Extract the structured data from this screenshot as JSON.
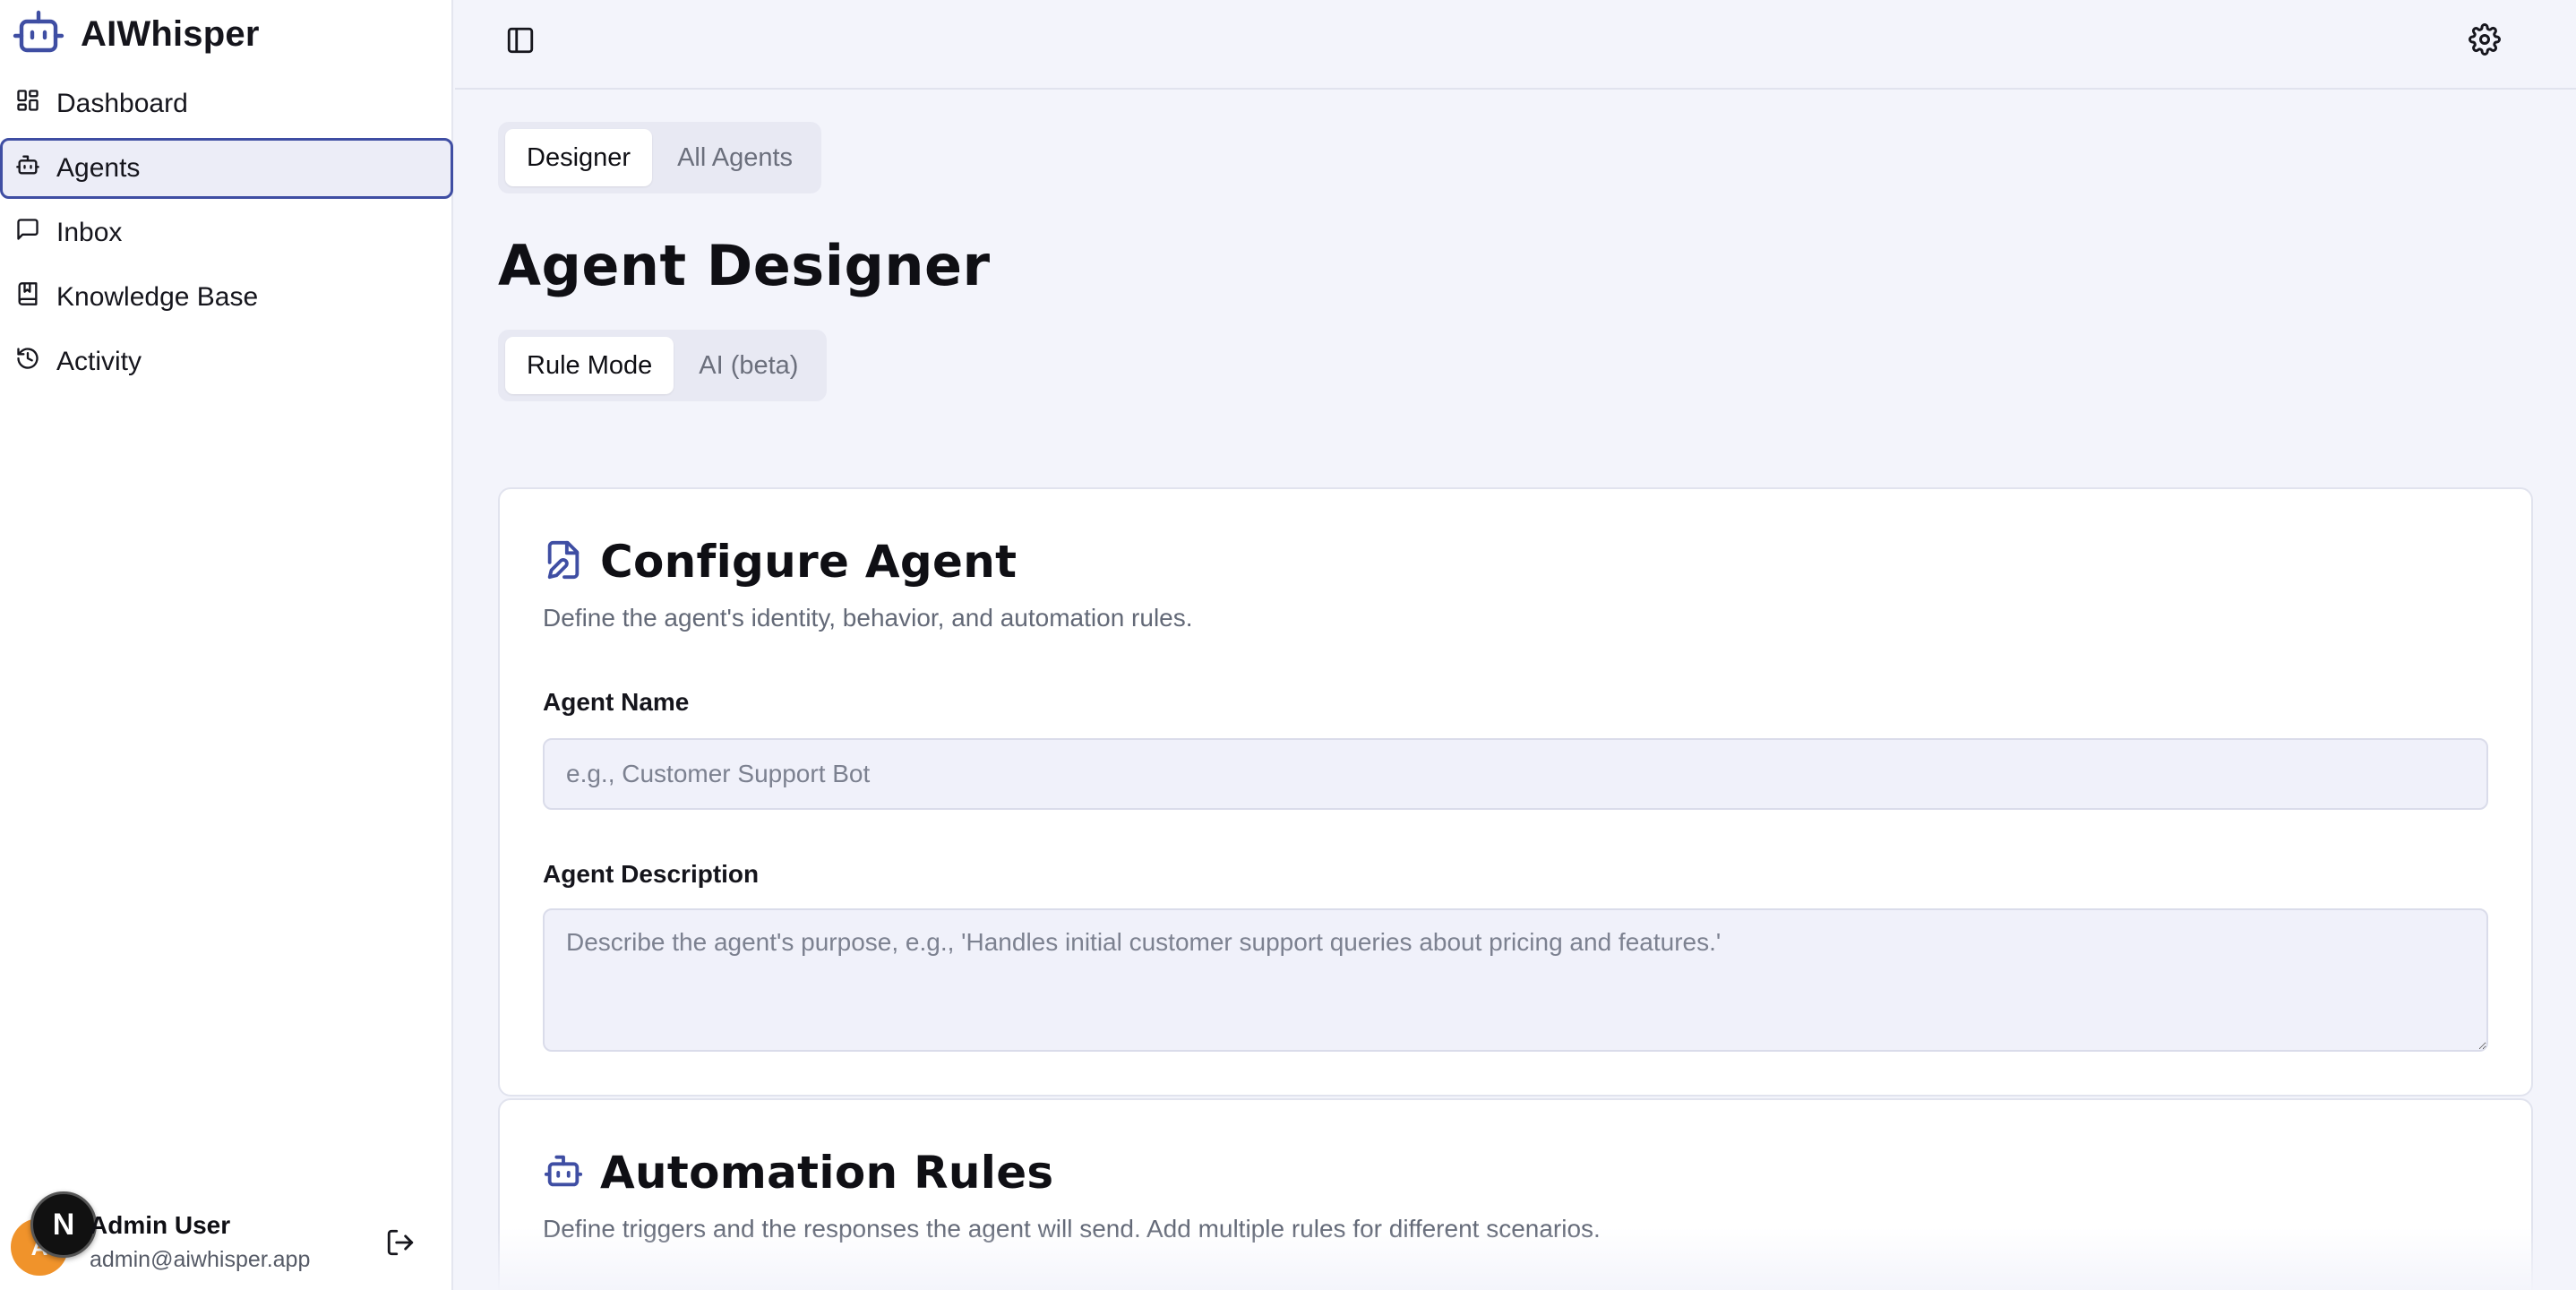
{
  "app": {
    "name": "AIWhisper"
  },
  "colors": {
    "accent": "#3f4ea3",
    "avatar": "#f0932b",
    "background": "#f3f4fb"
  },
  "sidebar": {
    "items": [
      {
        "label": "Dashboard",
        "icon": "dashboard-icon",
        "active": false
      },
      {
        "label": "Agents",
        "icon": "bot-icon",
        "active": true
      },
      {
        "label": "Inbox",
        "icon": "message-square-icon",
        "active": false
      },
      {
        "label": "Knowledge Base",
        "icon": "book-icon",
        "active": false
      },
      {
        "label": "Activity",
        "icon": "history-icon",
        "active": false
      }
    ],
    "user": {
      "name": "Admin User",
      "email": "admin@aiwhisper.app",
      "avatar_initial": "A",
      "dev_badge": "N"
    }
  },
  "header": {
    "toggle_icon": "panel-left-icon",
    "settings_icon": "gear-icon"
  },
  "main": {
    "tabs": [
      {
        "label": "Designer",
        "active": true
      },
      {
        "label": "All Agents",
        "active": false
      }
    ],
    "title": "Agent Designer",
    "mode_tabs": [
      {
        "label": "Rule Mode",
        "active": true
      },
      {
        "label": "AI (beta)",
        "active": false
      }
    ],
    "configure": {
      "icon": "file-edit-icon",
      "title": "Configure Agent",
      "description": "Define the agent's identity, behavior, and automation rules.",
      "name_label": "Agent Name",
      "name_placeholder": "e.g., Customer Support Bot",
      "name_value": "",
      "description_label": "Agent Description",
      "description_placeholder": "Describe the agent's purpose, e.g., 'Handles initial customer support queries about pricing and features.'",
      "description_value": ""
    },
    "rules": {
      "icon": "bot-icon",
      "title": "Automation Rules",
      "description": "Define triggers and the responses the agent will send. Add multiple rules for different scenarios."
    }
  }
}
